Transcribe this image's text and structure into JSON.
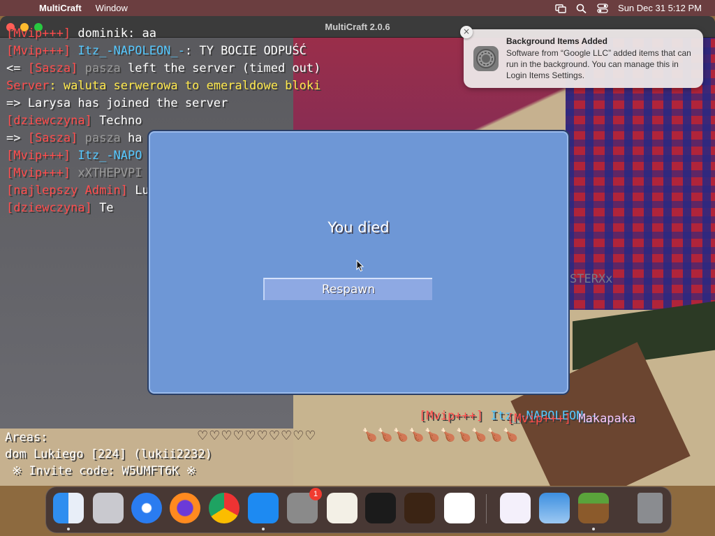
{
  "menubar": {
    "apple": "",
    "app_name": "MultiCraft",
    "menus": [
      "Window"
    ],
    "clock": "Sun Dec 31  5:12 PM"
  },
  "window": {
    "title": "MultiCraft 2.0.6"
  },
  "chat": {
    "lines": [
      [
        {
          "t": "[Mvip+++] ",
          "c": "red"
        },
        {
          "t": "dominik: aa",
          "c": "white"
        }
      ],
      [
        {
          "t": "[Mvip+++] ",
          "c": "red"
        },
        {
          "t": "Itz_-NAPOLEON_-",
          "c": "cyan"
        },
        {
          "t": ": TY BOCIE ODPUŚĆ",
          "c": "white"
        }
      ],
      [
        {
          "t": "<= ",
          "c": "white"
        },
        {
          "t": "[Sasza] ",
          "c": "red"
        },
        {
          "t": "pasza ",
          "c": "gray"
        },
        {
          "t": "left the server (timed out)",
          "c": "white"
        }
      ],
      [
        {
          "t": "Server",
          "c": "red"
        },
        {
          "t": ": waluta serwerowa to emeraldowe bloki",
          "c": "yellow"
        }
      ],
      [
        {
          "t": "=> Larysa has joined the server",
          "c": "white"
        }
      ],
      [
        {
          "t": "[dziewczyna] ",
          "c": "red"
        },
        {
          "t": "Techno",
          "c": "white"
        }
      ],
      [
        {
          "t": "=> ",
          "c": "white"
        },
        {
          "t": "[Sasza] ",
          "c": "red"
        },
        {
          "t": "pasza ",
          "c": "gray"
        },
        {
          "t": "ha",
          "c": "white"
        }
      ],
      [
        {
          "t": "[Mvip+++] ",
          "c": "red"
        },
        {
          "t": "Itz_-NAPO",
          "c": "cyan"
        }
      ],
      [
        {
          "t": "[Mvip+++] ",
          "c": "red"
        },
        {
          "t": "xXTHEPVPI",
          "c": "gray"
        }
      ],
      [
        {
          "t": "[najlepszy Admin] ",
          "c": "red"
        },
        {
          "t": "Lu",
          "c": "white"
        }
      ],
      [
        {
          "t": "      [dziewczyna] ",
          "c": "red"
        },
        {
          "t": "Te",
          "c": "white"
        }
      ]
    ]
  },
  "nametags": {
    "sterxx": "STERXx",
    "napoleon_prefix": "[Mvip+++] ",
    "napoleon_name": "Itz_-NAPOLEON_-",
    "makapaka_prefix": "[Mvip+++] ",
    "makapaka_name": "Makapaka"
  },
  "dialog": {
    "message": "You died",
    "button": "Respawn"
  },
  "areas": {
    "label": "Areas:",
    "area": "dom Lukiego [224] (lukii2232)",
    "invite": "※  Invite code: W5UMFT6K  ※"
  },
  "hud": {
    "hearts": "♡♡♡♡♡♡♡♡♡♡",
    "food": "🍗🍗🍗🍗🍗🍗🍗🍗🍗🍗"
  },
  "notification": {
    "title": "Background Items Added",
    "body": "Software from “Google LLC” added items that can run in the background. You can manage this in Login Items Settings.",
    "close": "×"
  },
  "dock": {
    "apps": [
      "finder",
      "launchpad",
      "safari",
      "firefox",
      "chrome",
      "app-store",
      "system-settings",
      "textedit",
      "terminal",
      "garageband",
      "vscode",
      "visual-studio",
      "weather",
      "multicraft",
      "trash"
    ],
    "badge": "1"
  },
  "colors": {
    "dialog_bg": "#6e97d6",
    "menubar_bg": "#6b3e40"
  }
}
